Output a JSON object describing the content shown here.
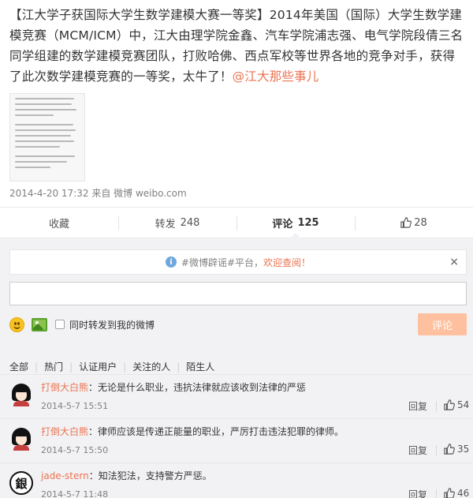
{
  "post": {
    "text": "【江大学子获国际大学生数学建模大赛一等奖】2014年美国（国际）大学生数学建模竞赛（MCM/ICM）中，江大由理学院金鑫、汽车学院浦志强、电气学院段倩三名同学组建的数学建模竞赛团队，打败哈佛、西点军校等世界各地的竞争对手，获得了此次数学建模竞赛的一等奖，太牛了！",
    "mention": "@江大那些事儿",
    "meta": "2014-4-20 17:32 来自 微博 weibo.com"
  },
  "actions": {
    "favorite": "收藏",
    "repost_label": "转发",
    "repost_count": "248",
    "comment_label": "评论",
    "comment_count": "125",
    "like_count": "28"
  },
  "notice": {
    "tag": "#微博辟谣#平台，",
    "highlight": "欢迎查阅！",
    "close": "×"
  },
  "reply": {
    "value": "",
    "checkbox_label": "同时转发到我的微博",
    "submit": "评论"
  },
  "filters": [
    "全部",
    "热门",
    "认证用户",
    "关注的人",
    "陌生人"
  ],
  "comments": [
    {
      "user": "打倒大白熊",
      "text": "：无论是什么职业，违抗法律就应该收到法律的严惩",
      "time": "2014-5-7 15:51",
      "reply": "回复",
      "likes": "54"
    },
    {
      "user": "打倒大白熊",
      "text": "：律师应该是传递正能量的职业，严厉打击违法犯罪的律师。",
      "time": "2014-5-7 15:50",
      "reply": "回复",
      "likes": "35"
    },
    {
      "user": "jade-stern",
      "text": "：知法犯法，支持警方严惩。",
      "time": "2014-5-7 11:48",
      "reply": "回复",
      "likes": "46",
      "avatar_glyph": "銀"
    }
  ]
}
